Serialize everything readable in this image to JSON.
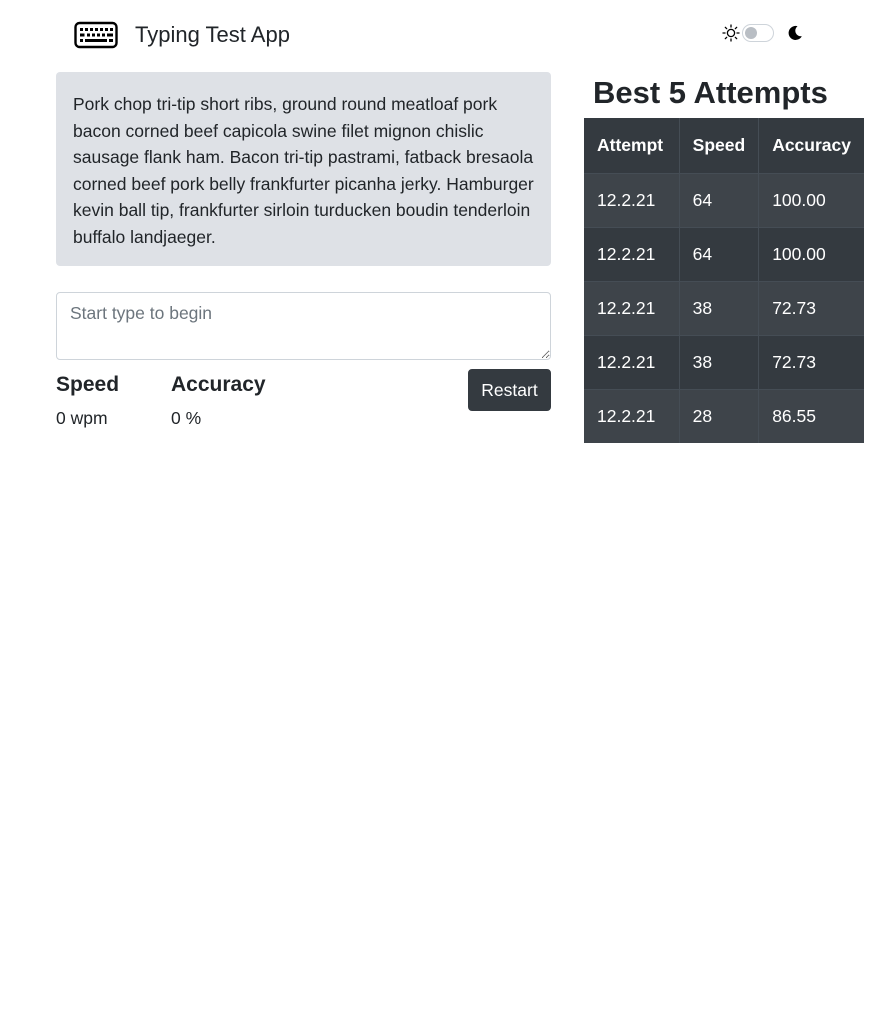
{
  "header": {
    "brand_icon": "keyboard-icon",
    "title": "Typing Test App",
    "theme_toggle": {
      "light_icon": "sun-icon",
      "dark_icon": "moon-icon",
      "dark_mode": false
    }
  },
  "passage": {
    "text": "Pork chop tri-tip short ribs, ground round meatloaf pork bacon corned beef capicola swine filet mignon chislic sausage flank ham. Bacon tri-tip pastrami, fatback bresaola corned beef pork belly frankfurter picanha jerky. Hamburger kevin ball tip, frankfurter sirloin turducken boudin tenderloin buffalo landjaeger."
  },
  "input": {
    "value": "",
    "placeholder": "Start type to begin"
  },
  "stats": {
    "speed_label": "Speed",
    "speed_value": "0 wpm",
    "accuracy_label": "Accuracy",
    "accuracy_value": "0 %"
  },
  "restart_label": "Restart",
  "attempts": {
    "title": "Best 5 Attempts",
    "columns": [
      "Attempt",
      "Speed",
      "Accuracy"
    ],
    "rows": [
      [
        "12.2.21",
        "64",
        "100.00"
      ],
      [
        "12.2.21",
        "64",
        "100.00"
      ],
      [
        "12.2.21",
        "38",
        "72.73"
      ],
      [
        "12.2.21",
        "38",
        "72.73"
      ],
      [
        "12.2.21",
        "28",
        "86.55"
      ]
    ]
  },
  "colors": {
    "table_dark": "#343a40",
    "table_stripe": "#3e444a",
    "passage_bg": "#dee1e6"
  }
}
